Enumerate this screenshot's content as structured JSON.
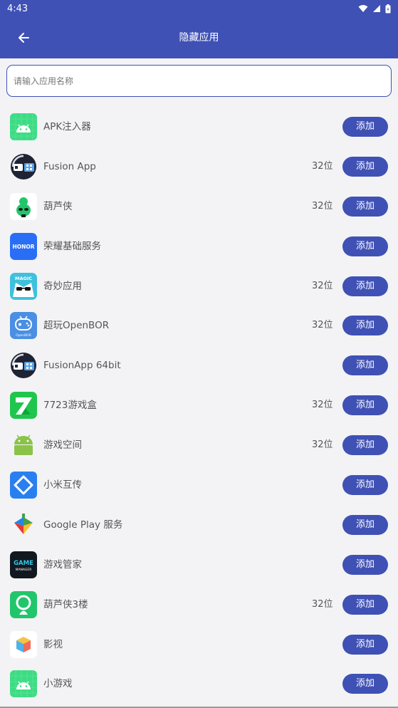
{
  "statusbar": {
    "time": "4:43"
  },
  "appbar": {
    "title": "隐藏应用"
  },
  "search": {
    "placeholder": "请输入应用名称",
    "value": ""
  },
  "apps": [
    {
      "name": "APK注入器",
      "bits": "",
      "add_label": "添加",
      "icon": "android-icon"
    },
    {
      "name": "Fusion App",
      "bits": "32位",
      "add_label": "添加",
      "icon": "fusion-app-icon"
    },
    {
      "name": "葫芦侠",
      "bits": "32位",
      "add_label": "添加",
      "icon": "huluxia-icon"
    },
    {
      "name": "荣耀基础服务",
      "bits": "",
      "add_label": "添加",
      "icon": "honor-icon",
      "icon_text": "HONOR"
    },
    {
      "name": "奇妙应用",
      "bits": "32位",
      "add_label": "添加",
      "icon": "magic-icon",
      "icon_text": "MAGIC"
    },
    {
      "name": "超玩OpenBOR",
      "bits": "32位",
      "add_label": "添加",
      "icon": "openbor-icon",
      "icon_text": "OpenBOR"
    },
    {
      "name": "FusionApp 64bit",
      "bits": "",
      "add_label": "添加",
      "icon": "fusion-app-icon"
    },
    {
      "name": "7723游戏盒",
      "bits": "32位",
      "add_label": "添加",
      "icon": "7723-icon"
    },
    {
      "name": "游戏空间",
      "bits": "32位",
      "add_label": "添加",
      "icon": "android-robot-icon"
    },
    {
      "name": "小米互传",
      "bits": "",
      "add_label": "添加",
      "icon": "mi-share-icon"
    },
    {
      "name": "Google Play 服务",
      "bits": "",
      "add_label": "添加",
      "icon": "google-play-services-icon"
    },
    {
      "name": "游戏管家",
      "bits": "",
      "add_label": "添加",
      "icon": "game-manager-icon",
      "icon_text": "GAME",
      "icon_subtext": "MANAGER"
    },
    {
      "name": "葫芦侠3楼",
      "bits": "32位",
      "add_label": "添加",
      "icon": "huluxia3-icon"
    },
    {
      "name": "影视",
      "bits": "",
      "add_label": "添加",
      "icon": "cube-icon"
    },
    {
      "name": "小游戏",
      "bits": "",
      "add_label": "添加",
      "icon": "android-icon"
    }
  ],
  "colors": {
    "primary": "#3f51b5",
    "background": "#f3f3f5",
    "text": "#555555"
  }
}
